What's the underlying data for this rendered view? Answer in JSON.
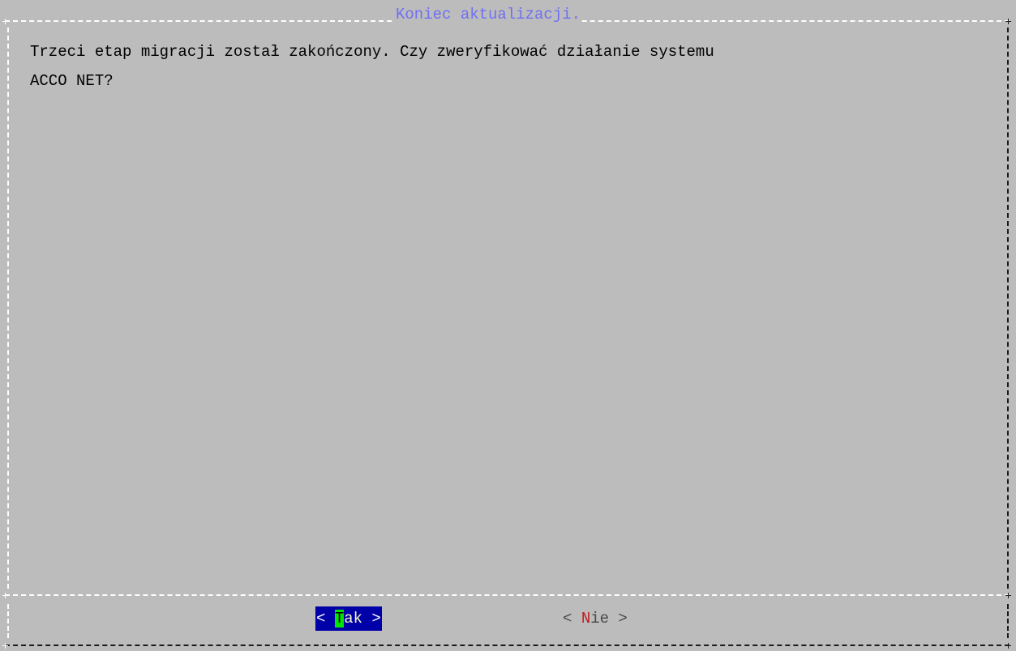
{
  "dialog": {
    "title": "Koniec aktualizacji.",
    "message": "Trzeci etap migracji został zakończony. Czy zweryfikować działanie systemu\nACCO NET?"
  },
  "buttons": {
    "yes": {
      "open": "< ",
      "hotkey": "T",
      "rest": "ak",
      "close": " >",
      "selected": true
    },
    "no": {
      "open": "< ",
      "hotkey": "N",
      "rest": "ie",
      "close": " >",
      "selected": false
    }
  },
  "colors": {
    "background": "#bcbcbc",
    "title": "#6f6ff2",
    "selected_button_bg": "#0000a8",
    "hotkey_highlight": "#00e400",
    "hotkey_text": "#c01a1a"
  }
}
